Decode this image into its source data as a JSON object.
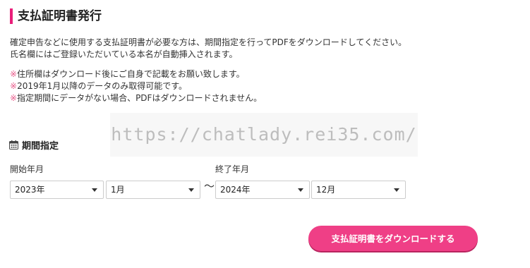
{
  "page": {
    "title": "支払証明書発行",
    "description": [
      "確定申告などに使用する支払証明書が必要な方は、期間指定を行ってPDFをダウンロードしてください。",
      "氏名欄にはご登録いただいている本名が自動挿入されます。"
    ],
    "notes": [
      {
        "mark": "※",
        "text": "住所欄はダウンロード後にご自身で記載をお願い致します。"
      },
      {
        "mark": "※",
        "text": "2019年1月以降のデータのみ取得可能です。"
      },
      {
        "mark": "※",
        "text": "指定期間にデータがない場合、PDFはダウンロードされません。"
      }
    ],
    "watermark": "https://chatlady.rei35.com/"
  },
  "period": {
    "heading": "期間指定",
    "start": {
      "label": "開始年月",
      "year": "2023年",
      "month": "1月"
    },
    "separator": "～",
    "end": {
      "label": "終了年月",
      "year": "2024年",
      "month": "12月"
    }
  },
  "actions": {
    "download_label": "支払証明書をダウンロードする"
  },
  "colors": {
    "accent": "#ef3f86",
    "title_bar": "#e91e7a",
    "note_mark": "#e85a8a"
  },
  "icons": {
    "period": "calendar-icon",
    "select": "chevron-down-icon"
  }
}
